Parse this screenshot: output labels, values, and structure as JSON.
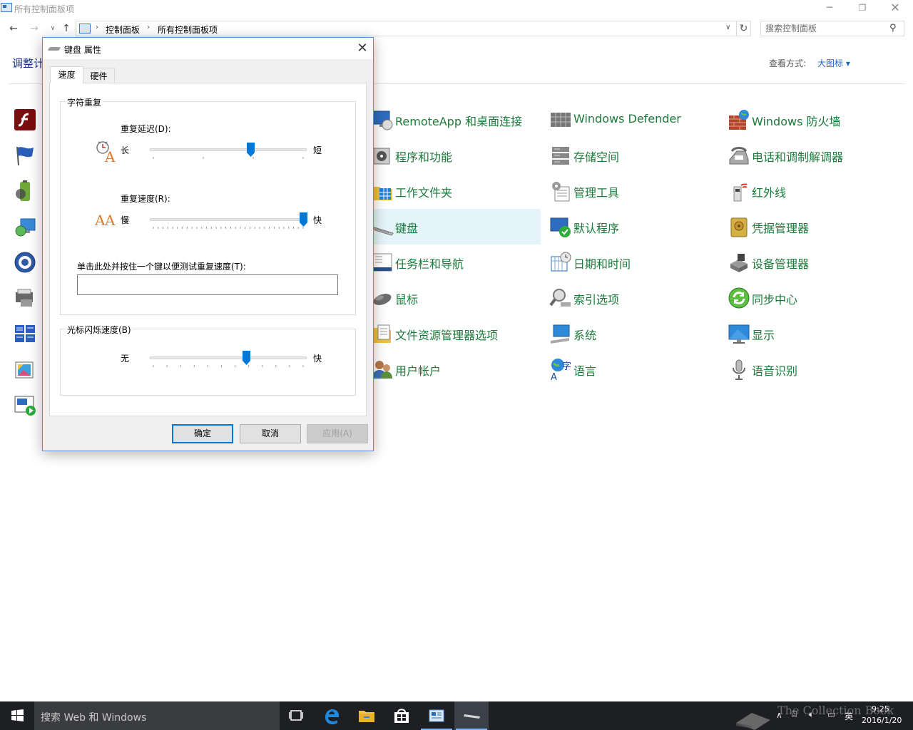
{
  "window": {
    "title": "所有控制面板项",
    "breadcrumb": [
      "控制面板",
      "所有控制面板项"
    ],
    "search_placeholder": "搜索控制面板",
    "heading": "调整计",
    "view_label": "查看方式:",
    "view_value": "大图标 ▾",
    "left_icons": [
      "flash-icon",
      "flag-icon",
      "battery-icon",
      "backup-icon",
      "ease-of-access-icon",
      "fonts-icon",
      "homegroup-icon",
      "color-management-icon",
      "autoplay-icon"
    ],
    "items_col1": [
      "RemoteApp 和桌面连接",
      "程序和功能",
      "工作文件夹",
      "键盘",
      "任务栏和导航",
      "鼠标",
      "文件资源管理器选项",
      "用户帐户"
    ],
    "items_col2": [
      "Windows Defender",
      "存储空间",
      "管理工具",
      "默认程序",
      "日期和时间",
      "索引选项",
      "系统",
      "语言"
    ],
    "items_col3": [
      "Windows 防火墙",
      "电话和调制解调器",
      "红外线",
      "凭据管理器",
      "设备管理器",
      "同步中心",
      "显示",
      "语音识别"
    ],
    "selected_item": "键盘"
  },
  "dialog": {
    "title": "键盘 属性",
    "tabs": [
      "速度",
      "硬件"
    ],
    "active_tab": "速度",
    "group_repeat": "字符重复",
    "repeat_delay_label": "重复延迟(D):",
    "delay_min": "长",
    "delay_max": "短",
    "delay_value": 0.65,
    "delay_positions": 4,
    "repeat_rate_label": "重复速度(R):",
    "rate_min": "慢",
    "rate_max": "快",
    "rate_value": 1.0,
    "rate_positions": 32,
    "test_label": "单击此处并按住一个键以便测试重复速度(T):",
    "test_value": "",
    "group_cursor": "光标闪烁速度(B)",
    "blink_min": "无",
    "blink_max": "快",
    "blink_value": 0.62,
    "blink_positions": 12,
    "ok": "确定",
    "cancel": "取消",
    "apply": "应用(A)"
  },
  "taskbar": {
    "search_placeholder": "搜索 Web 和 Windows",
    "time": "9:25",
    "date": "2016/1/20",
    "ime": "英",
    "watermark": "The Collection Book"
  },
  "colors": {
    "link_green": "#1a7a3a",
    "accent_blue": "#0078d7",
    "selection": "#e5f3fb",
    "taskbar": "#1e1f22"
  }
}
